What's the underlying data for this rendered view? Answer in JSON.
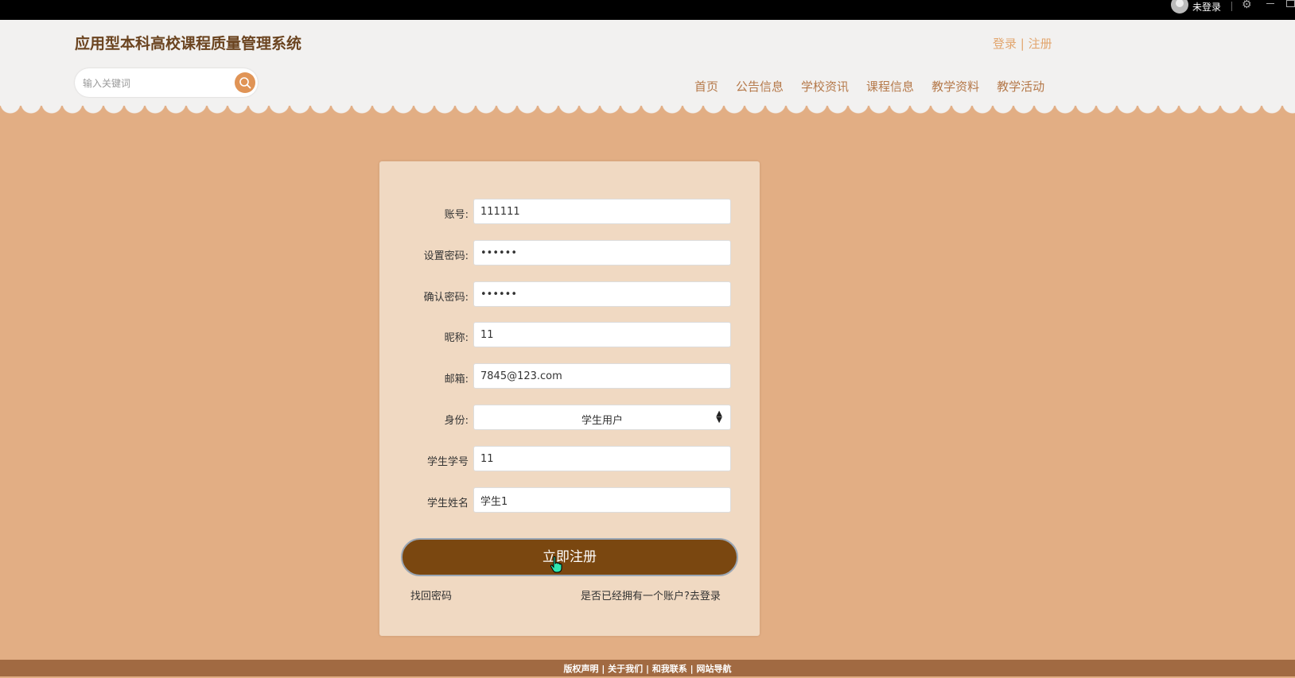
{
  "system_bar": {
    "user_label": "未登录"
  },
  "header": {
    "title": "应用型本科高校课程质量管理系统",
    "login": "登录",
    "separator": "|",
    "register": "注册",
    "search_placeholder": "输入关键词",
    "nav": [
      "首页",
      "公告信息",
      "学校资讯",
      "课程信息",
      "教学资料",
      "教学活动"
    ]
  },
  "form": {
    "fields": [
      {
        "label": "账号:",
        "value": "111111",
        "type": "text"
      },
      {
        "label": "设置密码:",
        "value": "111111",
        "type": "password"
      },
      {
        "label": "确认密码:",
        "value": "111111",
        "type": "password"
      },
      {
        "label": "昵称:",
        "value": "11",
        "type": "text"
      },
      {
        "label": "邮箱:",
        "value": "7845@123.com",
        "type": "text"
      },
      {
        "label": "身份:",
        "value": "学生用户",
        "type": "select"
      },
      {
        "label": "学生学号",
        "value": "11",
        "type": "text"
      },
      {
        "label": "学生姓名",
        "value": "学生1",
        "type": "text"
      }
    ],
    "submit_label": "立即注册",
    "forgot_password": "找回密码",
    "have_account": "是否已经拥有一个账户?去登录"
  },
  "footer": {
    "text": "版权声明 | 关于我们 | 和我联系 | 网站导航"
  },
  "colors": {
    "background": "#e2ae84",
    "header": "#f2f1f0",
    "title": "#6b4420",
    "nav": "#b5794a",
    "card": "#f0d9c2",
    "button": "#7a4710",
    "footer": "#a16a42"
  }
}
